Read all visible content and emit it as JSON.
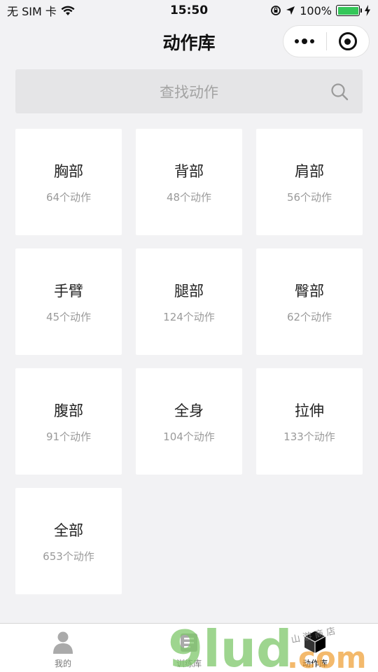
{
  "status_bar": {
    "carrier": "无 SIM 卡",
    "time": "15:50",
    "battery_percent": "100%",
    "battery_level": 1.0
  },
  "nav": {
    "title": "动作库"
  },
  "search": {
    "placeholder": "查找动作"
  },
  "categories": [
    {
      "name": "胸部",
      "count": "64个动作"
    },
    {
      "name": "背部",
      "count": "48个动作"
    },
    {
      "name": "肩部",
      "count": "56个动作"
    },
    {
      "name": "手臂",
      "count": "45个动作"
    },
    {
      "name": "腿部",
      "count": "124个动作"
    },
    {
      "name": "臀部",
      "count": "62个动作"
    },
    {
      "name": "腹部",
      "count": "91个动作"
    },
    {
      "name": "全身",
      "count": "104个动作"
    },
    {
      "name": "拉伸",
      "count": "133个动作"
    },
    {
      "name": "全部",
      "count": "653个动作"
    }
  ],
  "tabs": [
    {
      "label": "我的",
      "icon": "person-icon"
    },
    {
      "label": "训练库",
      "icon": "training-icon"
    },
    {
      "label": "动作库",
      "icon": "cube-icon"
    }
  ],
  "colors": {
    "battery": "#34c759",
    "background": "#f2f2f4"
  }
}
